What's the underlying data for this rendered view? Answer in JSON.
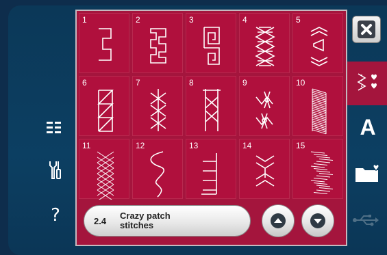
{
  "left_menu": {
    "menu_icon": "list-menu-icon",
    "tools_icon": "settings-tools-icon",
    "help_symbol": "?"
  },
  "stitches": [
    {
      "number": "1",
      "pattern": "greek-key-1"
    },
    {
      "number": "2",
      "pattern": "greek-key-2"
    },
    {
      "number": "3",
      "pattern": "greek-key-spiral"
    },
    {
      "number": "4",
      "pattern": "braided-cross"
    },
    {
      "number": "5",
      "pattern": "chevron-arrows"
    },
    {
      "number": "6",
      "pattern": "twisted-ribbon"
    },
    {
      "number": "7",
      "pattern": "star-cross-chain"
    },
    {
      "number": "8",
      "pattern": "ladder-cross"
    },
    {
      "number": "9",
      "pattern": "zigzag-cross"
    },
    {
      "number": "10",
      "pattern": "satin-slant"
    },
    {
      "number": "11",
      "pattern": "lattice-fill"
    },
    {
      "number": "12",
      "pattern": "serpentine"
    },
    {
      "number": "13",
      "pattern": "comb-edge"
    },
    {
      "number": "14",
      "pattern": "feather-chevron"
    },
    {
      "number": "15",
      "pattern": "zigzag-satin"
    }
  ],
  "category": {
    "code": "2.4",
    "name": "Crazy patch\nstitches"
  },
  "scroll": {
    "up_icon": "arrow-up-icon",
    "down_icon": "arrow-down-icon"
  },
  "right_bar": {
    "close_icon": "close-icon",
    "stitch_tab_icon": "stitch-hearts-icon",
    "font_tab_label": "A",
    "folder_icon": "personal-folder-icon",
    "usb_icon": "usb-icon"
  },
  "colors": {
    "panel": "#a4153d",
    "cell": "#b0103d",
    "screen": "#0c3f62",
    "frame": "#0e2d4c"
  }
}
